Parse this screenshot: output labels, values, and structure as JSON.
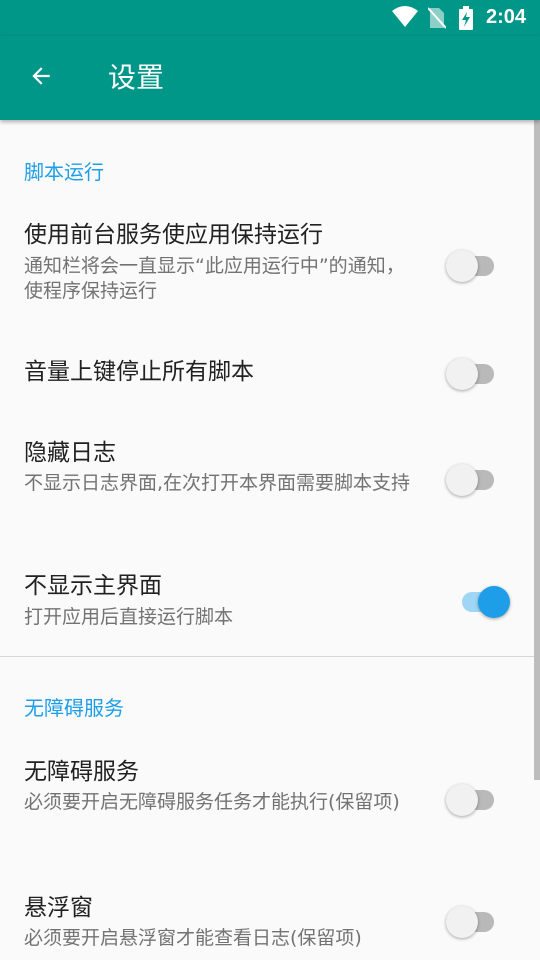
{
  "status_bar": {
    "time": "2:04",
    "icons": [
      "wifi-icon",
      "no-sim-icon",
      "battery-charging-icon"
    ]
  },
  "toolbar": {
    "title": "设置",
    "back_icon": "arrow-left-icon"
  },
  "sections": [
    {
      "header": "脚本运行",
      "items": [
        {
          "title": "使用前台服务使应用保持运行",
          "summary": "通知栏将会一直显示“此应用运行中”的通知，使程序保持运行",
          "checked": false
        },
        {
          "title": "音量上键停止所有脚本",
          "summary": "",
          "checked": false
        },
        {
          "title": "隐藏日志",
          "summary": "不显示日志界面,在次打开本界面需要脚本支持",
          "checked": false
        },
        {
          "title": "不显示主界面",
          "summary": "打开应用后直接运行脚本",
          "checked": true
        }
      ]
    },
    {
      "header": "无障碍服务",
      "items": [
        {
          "title": "无障碍服务",
          "summary": "必须要开启无障碍服务任务才能执行(保留项)",
          "checked": false
        },
        {
          "title": "悬浮窗",
          "summary": "必须要开启悬浮窗才能查看日志(保留项)",
          "checked": false
        }
      ]
    }
  ],
  "colors": {
    "primary": "#009688",
    "accent": "#1e9ee8"
  }
}
